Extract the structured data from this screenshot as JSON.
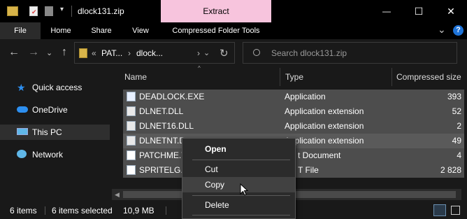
{
  "window": {
    "title": "dlock131.zip",
    "contextual_tab": "Extract",
    "minimize_glyph": "—",
    "maximize_glyph": "☐",
    "close_glyph": "✕"
  },
  "ribbon": {
    "tabs": [
      "File",
      "Home",
      "Share",
      "View",
      "Compressed Folder Tools"
    ],
    "collapse_glyph": "⌄",
    "help_glyph": "?"
  },
  "nav": {
    "back_glyph": "←",
    "forward_glyph": "→",
    "recent_glyph": "⌄",
    "up_glyph": "↑",
    "address_prefix": "«",
    "address_parts": [
      "PAT...",
      "dlock..."
    ],
    "address_sep": "›",
    "refresh_glyph": "↻",
    "search_placeholder": "Search dlock131.zip"
  },
  "sidebar": {
    "items": [
      {
        "label": "Quick access",
        "icon": "star-icon"
      },
      {
        "label": "OneDrive",
        "icon": "cloud-icon"
      },
      {
        "label": "This PC",
        "icon": "computer-icon",
        "selected": true
      },
      {
        "label": "Network",
        "icon": "network-icon"
      }
    ]
  },
  "columns": {
    "name": "Name",
    "type": "Type",
    "compressed_size": "Compressed size"
  },
  "files": [
    {
      "name": "DEADLOCK.EXE",
      "type": "Application",
      "size": "393"
    },
    {
      "name": "DLNET.DLL",
      "type": "Application extension",
      "size": "52"
    },
    {
      "name": "DLNET16.DLL",
      "type": "Application extension",
      "size": "2"
    },
    {
      "name": "DLNETNT.D",
      "type": "Application extension",
      "size": "49"
    },
    {
      "name": "PATCHME.T",
      "type": "t Document",
      "size": "4"
    },
    {
      "name": "SPRITELG.D",
      "type": "T File",
      "size": "2 828"
    }
  ],
  "context_menu": {
    "items": [
      "Open",
      "Cut",
      "Copy",
      "Delete"
    ],
    "highlighted": "Copy"
  },
  "status": {
    "item_count": "6 items",
    "selected": "6 items selected",
    "size": "10,9 MB"
  },
  "colors": {
    "accent": "#f7c4dd",
    "selection": "#4d4d4d",
    "background": "#191919"
  }
}
